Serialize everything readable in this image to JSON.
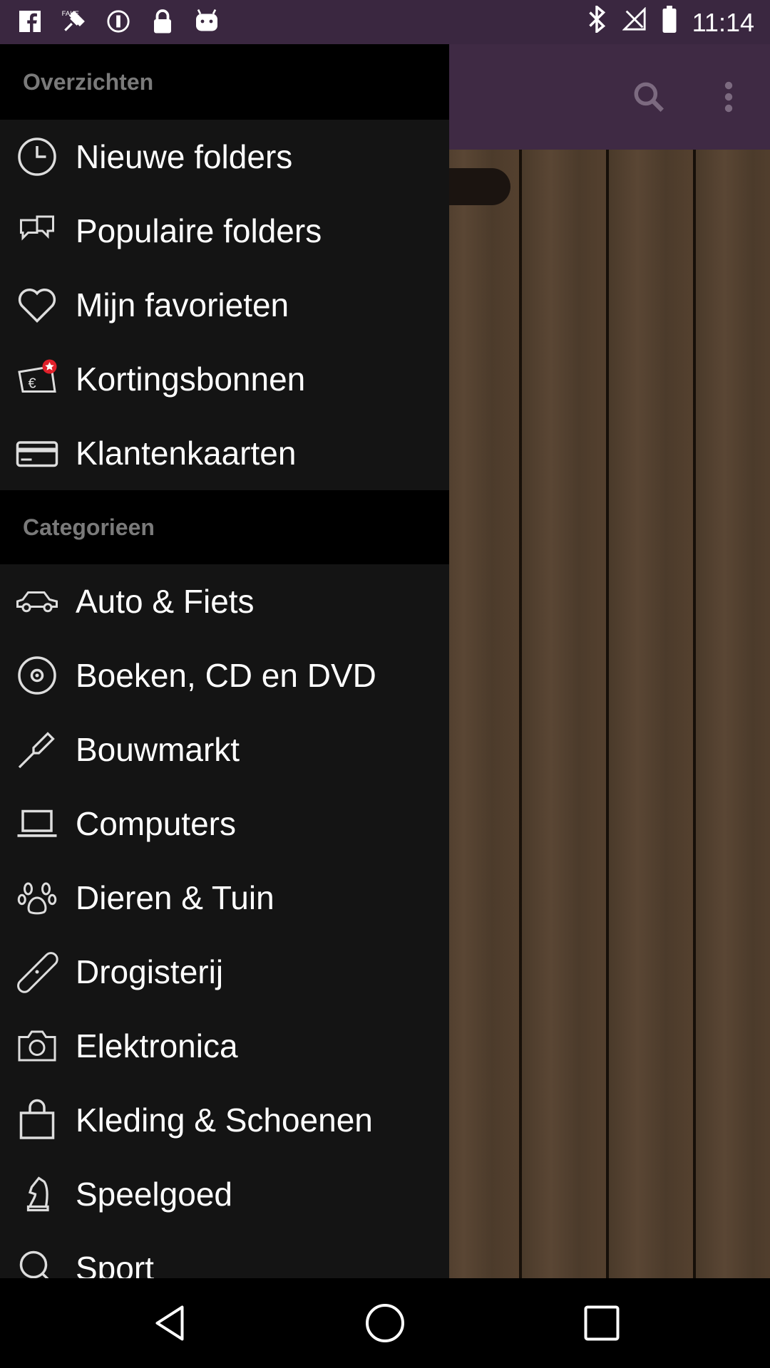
{
  "status_bar": {
    "time": "11:14",
    "left_icons": [
      "facebook-icon",
      "fake-gps-icon",
      "alert-circle-icon",
      "lock-icon",
      "android-icon"
    ],
    "right_icons": [
      "bluetooth-icon",
      "no-signal-icon",
      "battery-icon"
    ]
  },
  "app_bar": {
    "actions": [
      "search-icon",
      "more-vert-icon"
    ]
  },
  "drawer": {
    "sections": [
      {
        "header": "Overzichten",
        "items": [
          {
            "label": "Nieuwe folders",
            "icon": "clock-icon"
          },
          {
            "label": "Populaire folders",
            "icon": "popular-icon"
          },
          {
            "label": "Mijn favorieten",
            "icon": "heart-icon"
          },
          {
            "label": "Kortingsbonnen",
            "icon": "coupon-icon"
          },
          {
            "label": "Klantenkaarten",
            "icon": "card-icon"
          }
        ]
      },
      {
        "header": "Categorieen",
        "items": [
          {
            "label": "Auto & Fiets",
            "icon": "car-icon"
          },
          {
            "label": "Boeken, CD en DVD",
            "icon": "disc-icon"
          },
          {
            "label": "Bouwmarkt",
            "icon": "screwdriver-icon"
          },
          {
            "label": "Computers",
            "icon": "laptop-icon"
          },
          {
            "label": "Dieren & Tuin",
            "icon": "paw-icon"
          },
          {
            "label": "Drogisterij",
            "icon": "bandage-icon"
          },
          {
            "label": "Elektronica",
            "icon": "camera-icon"
          },
          {
            "label": "Kleding & Schoenen",
            "icon": "shopping-bag-icon"
          },
          {
            "label": "Speelgoed",
            "icon": "chess-knight-icon"
          },
          {
            "label": "Sport",
            "icon": "sport-icon"
          }
        ]
      }
    ]
  },
  "nav_bar": {
    "buttons": [
      "back-icon",
      "home-icon",
      "recents-icon"
    ]
  },
  "colors": {
    "status_bar": "#3a2740",
    "app_bar": "#3f2a44",
    "drawer_bg": "#141414",
    "header_bg": "#000000",
    "header_text": "#7a7a7a"
  }
}
